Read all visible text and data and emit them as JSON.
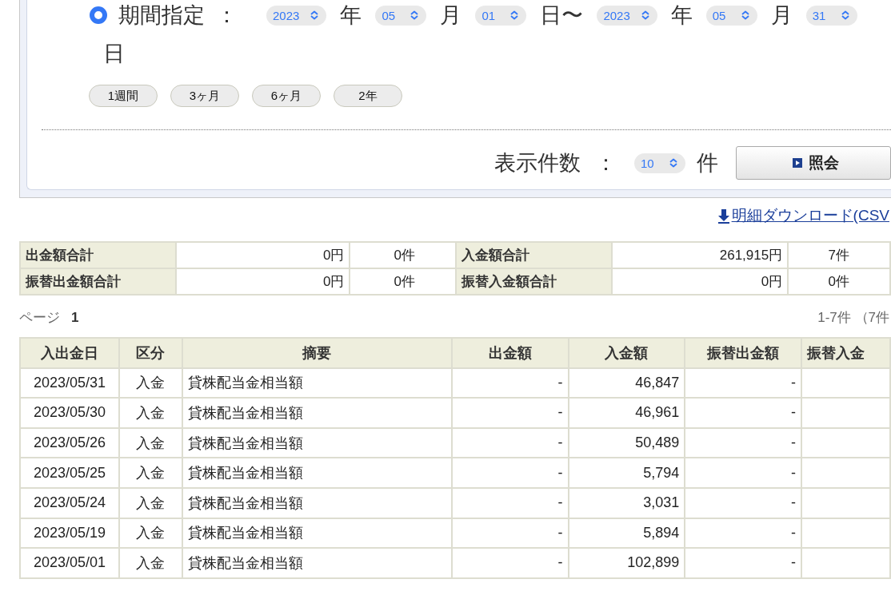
{
  "period": {
    "radio": {
      "selected": true
    },
    "label": "期間指定",
    "colon": "：",
    "parts": [
      {
        "kind": "select",
        "value": "2023"
      },
      {
        "kind": "text",
        "value": "年"
      },
      {
        "kind": "select",
        "value": "05"
      },
      {
        "kind": "text",
        "value": "月"
      },
      {
        "kind": "select",
        "value": "01"
      },
      {
        "kind": "text",
        "value": "日〜"
      },
      {
        "kind": "select",
        "value": "2023"
      },
      {
        "kind": "text",
        "value": "年"
      },
      {
        "kind": "select",
        "value": "05"
      },
      {
        "kind": "text",
        "value": "月"
      },
      {
        "kind": "select",
        "value": "31"
      },
      {
        "kind": "text",
        "value": "日"
      }
    ]
  },
  "quick_buttons": [
    "1週間",
    "3ヶ月",
    "6ヶ月",
    "2年"
  ],
  "count": {
    "label": "表示件数",
    "colon": "：",
    "value": "10",
    "unit": "件"
  },
  "search_button": "照会",
  "download_link": "明細ダウンロード(CSV",
  "summary": {
    "rows": [
      [
        "出金額合計",
        "0円",
        "0件",
        "入金額合計",
        "261,915円",
        "7件"
      ],
      [
        "振替出金額合計",
        "0円",
        "0件",
        "振替入金額合計",
        "0円",
        "0件"
      ]
    ]
  },
  "page": {
    "label": "ページ",
    "number": "1",
    "range": "1-7件 （7件"
  },
  "table": {
    "columns": [
      "入出金日",
      "区分",
      "摘要",
      "出金額",
      "入金額",
      "振替出金額",
      "振替入金"
    ],
    "rows": [
      [
        "2023/05/31",
        "入金",
        "貸株配当金相当額",
        "-",
        "46,847",
        "-"
      ],
      [
        "2023/05/30",
        "入金",
        "貸株配当金相当額",
        "-",
        "46,961",
        "-"
      ],
      [
        "2023/05/26",
        "入金",
        "貸株配当金相当額",
        "-",
        "50,489",
        "-"
      ],
      [
        "2023/05/25",
        "入金",
        "貸株配当金相当額",
        "-",
        "5,794",
        "-"
      ],
      [
        "2023/05/24",
        "入金",
        "貸株配当金相当額",
        "-",
        "3,031",
        "-"
      ],
      [
        "2023/05/19",
        "入金",
        "貸株配当金相当額",
        "-",
        "5,894",
        "-"
      ],
      [
        "2023/05/01",
        "入金",
        "貸株配当金相当額",
        "-",
        "102,899",
        "-"
      ]
    ]
  }
}
